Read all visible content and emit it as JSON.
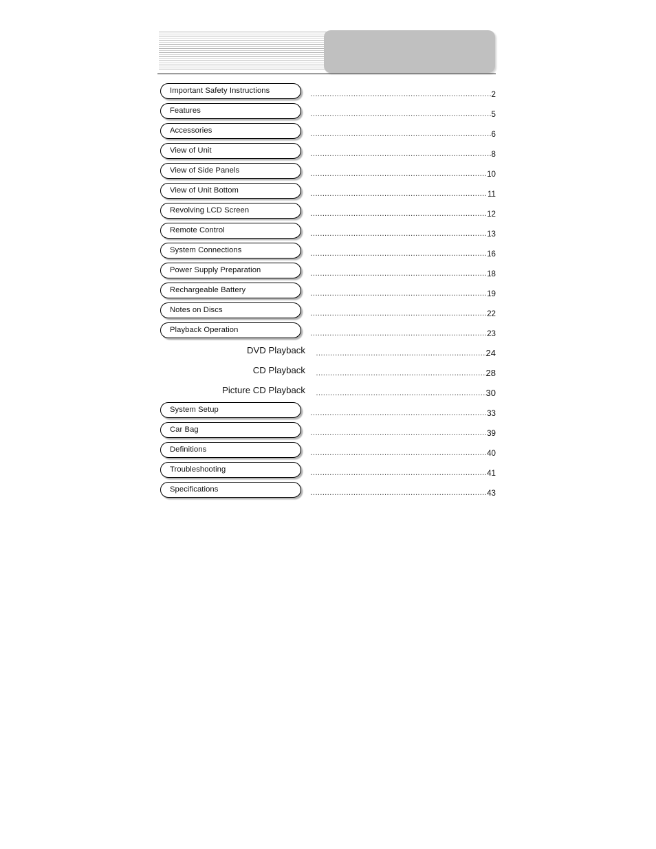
{
  "document": {
    "type": "table-of-contents",
    "header": {
      "stripe_band_label": "decorative-stripes",
      "gray_panel_label": "decorative-gray-panel",
      "gray_panel_color": "#c0c0c0",
      "stripe_color": "#b5b5b5",
      "rule_color": "#111111"
    }
  },
  "toc": {
    "leader_dots": "……………………………………………………………………………………………………",
    "entries": [
      {
        "label": "Important Safety Instructions",
        "page": "2",
        "style": "pill"
      },
      {
        "label": "Features",
        "page": "5",
        "style": "pill"
      },
      {
        "label": "Accessories",
        "page": "6",
        "style": "pill"
      },
      {
        "label": "View of Unit",
        "page": "8",
        "style": "pill"
      },
      {
        "label": "View of Side Panels",
        "page": "10",
        "style": "pill"
      },
      {
        "label": "View of Unit Bottom",
        "page": "11",
        "style": "pill"
      },
      {
        "label": "Revolving LCD Screen",
        "page": "12",
        "style": "pill"
      },
      {
        "label": "Remote Control",
        "page": "13",
        "style": "pill"
      },
      {
        "label": "System Connections",
        "page": "16",
        "style": "pill"
      },
      {
        "label": "Power Supply Preparation",
        "page": "18",
        "style": "pill"
      },
      {
        "label": "Rechargeable Battery",
        "page": "19",
        "style": "pill"
      },
      {
        "label": "Notes on Discs",
        "page": "22",
        "style": "pill"
      },
      {
        "label": "Playback Operation",
        "page": "23",
        "style": "pill"
      },
      {
        "label": "DVD Playback",
        "page": "24",
        "style": "sub"
      },
      {
        "label": "CD Playback",
        "page": "28",
        "style": "sub"
      },
      {
        "label": "Picture CD Playback",
        "page": "30",
        "style": "sub"
      },
      {
        "label": "System Setup",
        "page": "33",
        "style": "pill"
      },
      {
        "label": "Car Bag",
        "page": "39",
        "style": "pill"
      },
      {
        "label": "Definitions",
        "page": "40",
        "style": "pill"
      },
      {
        "label": "Troubleshooting",
        "page": "41",
        "style": "pill"
      },
      {
        "label": "Specifications",
        "page": "43",
        "style": "pill"
      }
    ]
  }
}
